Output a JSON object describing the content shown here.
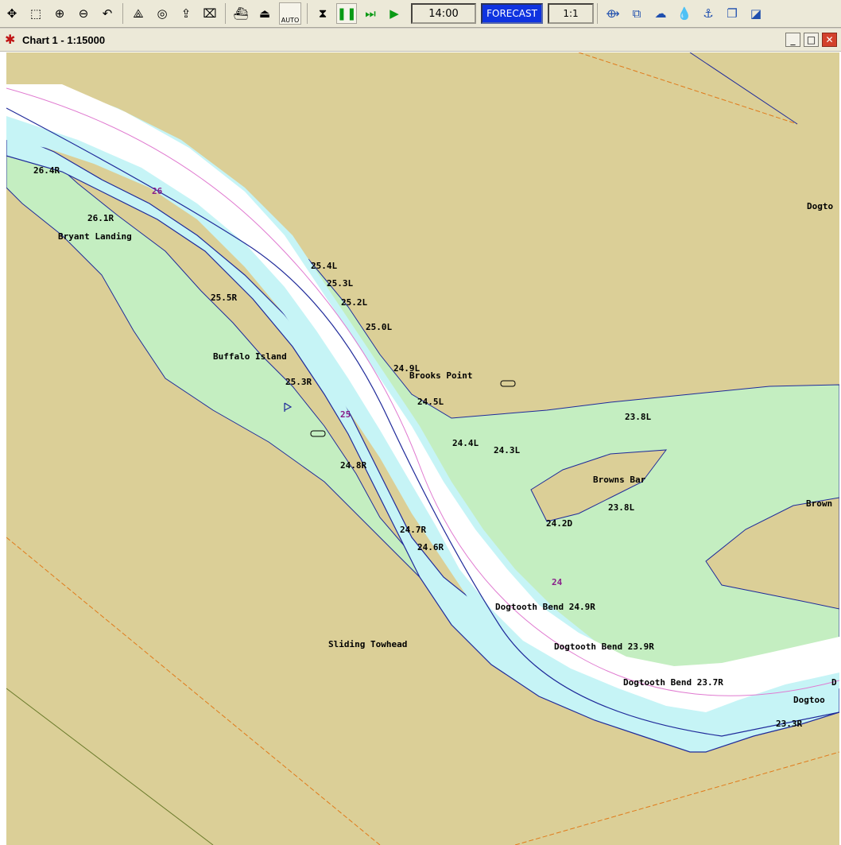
{
  "toolbar": {
    "time": "14:00",
    "forecast_label": "FORECAST",
    "scale_label": "1:1",
    "auto_label": "AUTO"
  },
  "window": {
    "title": "Chart 1 - 1:15000"
  },
  "colors": {
    "land": "#dbcf97",
    "shallow_green": "#c4eec1",
    "water_cyan": "#c6f4f6",
    "channel_white": "#ffffff",
    "shoreline": "#1f2a9a",
    "sailing_line": "#e07ad0",
    "mile_marker": "#8a1f8a",
    "forecast_bg": "#0f33e0"
  },
  "map": {
    "mile_markers": [
      "26",
      "25",
      "24"
    ],
    "place_labels": [
      "Bryant Landing",
      "Buffalo Island",
      "Brooks Point",
      "Browns Bar",
      "Brown",
      "Sliding Towhead",
      "Dogto",
      "Dogtooth Bend 24.9R",
      "Dogtooth Bend 23.9R",
      "Dogtooth Bend 23.7R",
      "Dogtoo",
      "D"
    ],
    "light_labels": [
      "26.4R",
      "26.1R",
      "25.5R",
      "25.4L",
      "25.3L",
      "25.2L",
      "25.0L",
      "24.9L",
      "25.3R",
      "24.5L",
      "24.4L",
      "24.3L",
      "24.8R",
      "23.8L",
      "23.8L",
      "24.2D",
      "24.7R",
      "24.6R",
      "23.3R"
    ]
  }
}
